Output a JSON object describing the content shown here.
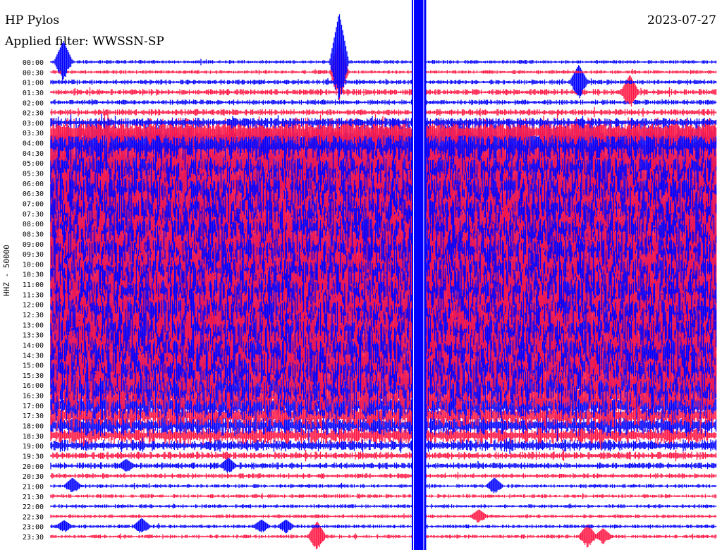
{
  "header": {
    "station": "HP Pylos",
    "date": "2023-07-27",
    "filter": "Applied filter: WWSSN-SP"
  },
  "chart_data": {
    "type": "line",
    "title": "HP Pylos",
    "ylabel": "HHZ - 50000",
    "xlim_minutes": [
      0,
      30
    ],
    "row_labels": [
      "00:00",
      "00:30",
      "01:00",
      "01:30",
      "02:00",
      "02:30",
      "03:00",
      "03:30",
      "04:00",
      "04:30",
      "05:00",
      "05:30",
      "06:00",
      "06:30",
      "07:00",
      "07:30",
      "08:00",
      "08:30",
      "09:00",
      "09:30",
      "10:00",
      "10:30",
      "11:00",
      "11:30",
      "12:00",
      "12:30",
      "13:00",
      "13:30",
      "14:00",
      "14:30",
      "15:00",
      "15:30",
      "16:00",
      "16:30",
      "17:00",
      "17:30",
      "18:00",
      "18:30",
      "19:00",
      "19:30",
      "20:00",
      "20:30",
      "21:00",
      "21:30",
      "22:00",
      "22:30",
      "23:00",
      "23:30"
    ],
    "colors": [
      "#0000ff",
      "#ff1744"
    ],
    "noise_amplitude": [
      3,
      3,
      4,
      5,
      4,
      5,
      7,
      22,
      35,
      40,
      42,
      42,
      45,
      45,
      45,
      45,
      45,
      45,
      45,
      45,
      45,
      45,
      45,
      45,
      45,
      45,
      45,
      45,
      45,
      45,
      42,
      40,
      35,
      30,
      25,
      20,
      16,
      14,
      9,
      6,
      5,
      4,
      3,
      3,
      3,
      3,
      3,
      3
    ],
    "data_gap": {
      "x_minutes_start": 16.27,
      "x_minutes_end": 16.92,
      "color": "#0000ff"
    },
    "events": [
      {
        "row": 0,
        "x_min": 0.57,
        "amplitude": 30
      },
      {
        "row": 0,
        "x_min": 13.0,
        "amplitude": 70
      },
      {
        "row": 1,
        "x_min": 13.0,
        "amplitude": 45
      },
      {
        "row": 2,
        "x_min": 23.8,
        "amplitude": 25
      },
      {
        "row": 3,
        "x_min": 26.1,
        "amplitude": 25
      },
      {
        "row": 40,
        "x_min": 3.4,
        "amplitude": 10
      },
      {
        "row": 40,
        "x_min": 8.0,
        "amplitude": 12
      },
      {
        "row": 42,
        "x_min": 0.98,
        "amplitude": 12
      },
      {
        "row": 42,
        "x_min": 20.0,
        "amplitude": 12
      },
      {
        "row": 45,
        "x_min": 19.3,
        "amplitude": 10
      },
      {
        "row": 46,
        "x_min": 0.6,
        "amplitude": 9
      },
      {
        "row": 46,
        "x_min": 4.1,
        "amplitude": 12
      },
      {
        "row": 46,
        "x_min": 9.5,
        "amplitude": 10
      },
      {
        "row": 46,
        "x_min": 10.6,
        "amplitude": 10
      },
      {
        "row": 47,
        "x_min": 12.0,
        "amplitude": 22
      },
      {
        "row": 47,
        "x_min": 24.2,
        "amplitude": 18
      },
      {
        "row": 47,
        "x_min": 24.9,
        "amplitude": 12
      }
    ]
  }
}
